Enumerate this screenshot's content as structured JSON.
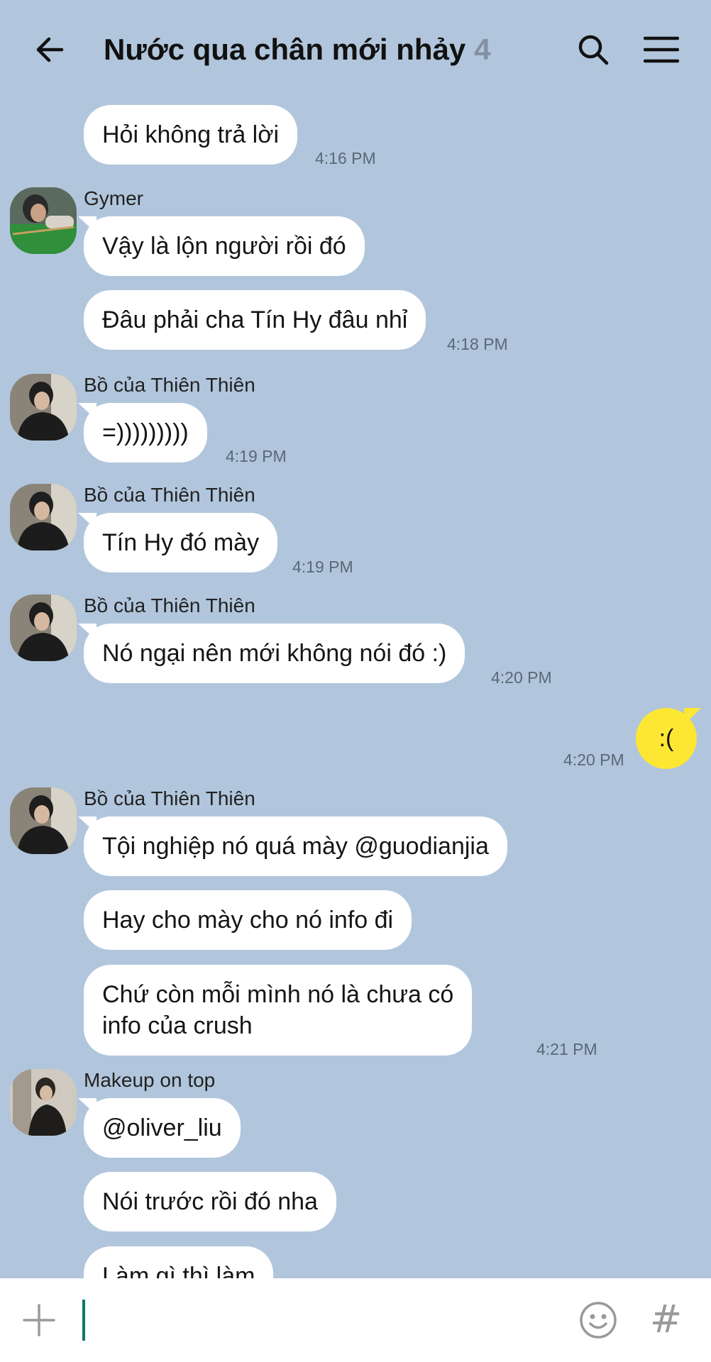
{
  "header": {
    "title": "Nước qua chân mới nhảy",
    "member_count": "4",
    "back_icon": "arrow-left-icon",
    "search_icon": "search-icon",
    "menu_icon": "hamburger-menu-icon"
  },
  "messages": [
    {
      "text": "Hỏi không trả lời",
      "time": "4:16 PM"
    },
    {
      "sender": "Gymer",
      "text": "Vậy là lộn người rồi đó"
    },
    {
      "text": "Đâu phải cha Tín Hy đâu nhỉ",
      "time": "4:18 PM"
    },
    {
      "sender": "Bồ của Thiên Thiên",
      "text": "=)))))))))",
      "time": "4:19 PM"
    },
    {
      "sender": "Bồ của Thiên Thiên",
      "text": "Tín Hy đó mày",
      "time": "4:19 PM"
    },
    {
      "sender": "Bồ của Thiên Thiên",
      "text": "Nó ngại nên mới không nói đó :)",
      "time": "4:20 PM"
    },
    {
      "text": ":(",
      "time": "4:20 PM",
      "mine": true
    },
    {
      "sender": "Bồ của Thiên Thiên",
      "text": "Tội nghiệp nó quá mày @guodianjia"
    },
    {
      "text": "Hay cho mày cho nó info đi"
    },
    {
      "text_line1": "Chứ còn mỗi mình nó là chưa có",
      "text_line2": "info của crush",
      "time": "4:21 PM"
    },
    {
      "sender": "Makeup on top",
      "text": "@oliver_liu"
    },
    {
      "text": "Nói trước rồi đó nha"
    },
    {
      "text": "Làm gì thì làm"
    }
  ],
  "input": {
    "placeholder": "",
    "plus_icon": "plus-icon",
    "emoji_icon": "emoji-icon",
    "hash_label": "#"
  },
  "colors": {
    "background": "#b1c6dc",
    "my_bubble": "#fde733",
    "other_bubble": "#ffffff",
    "caret": "#0d7a6a"
  }
}
